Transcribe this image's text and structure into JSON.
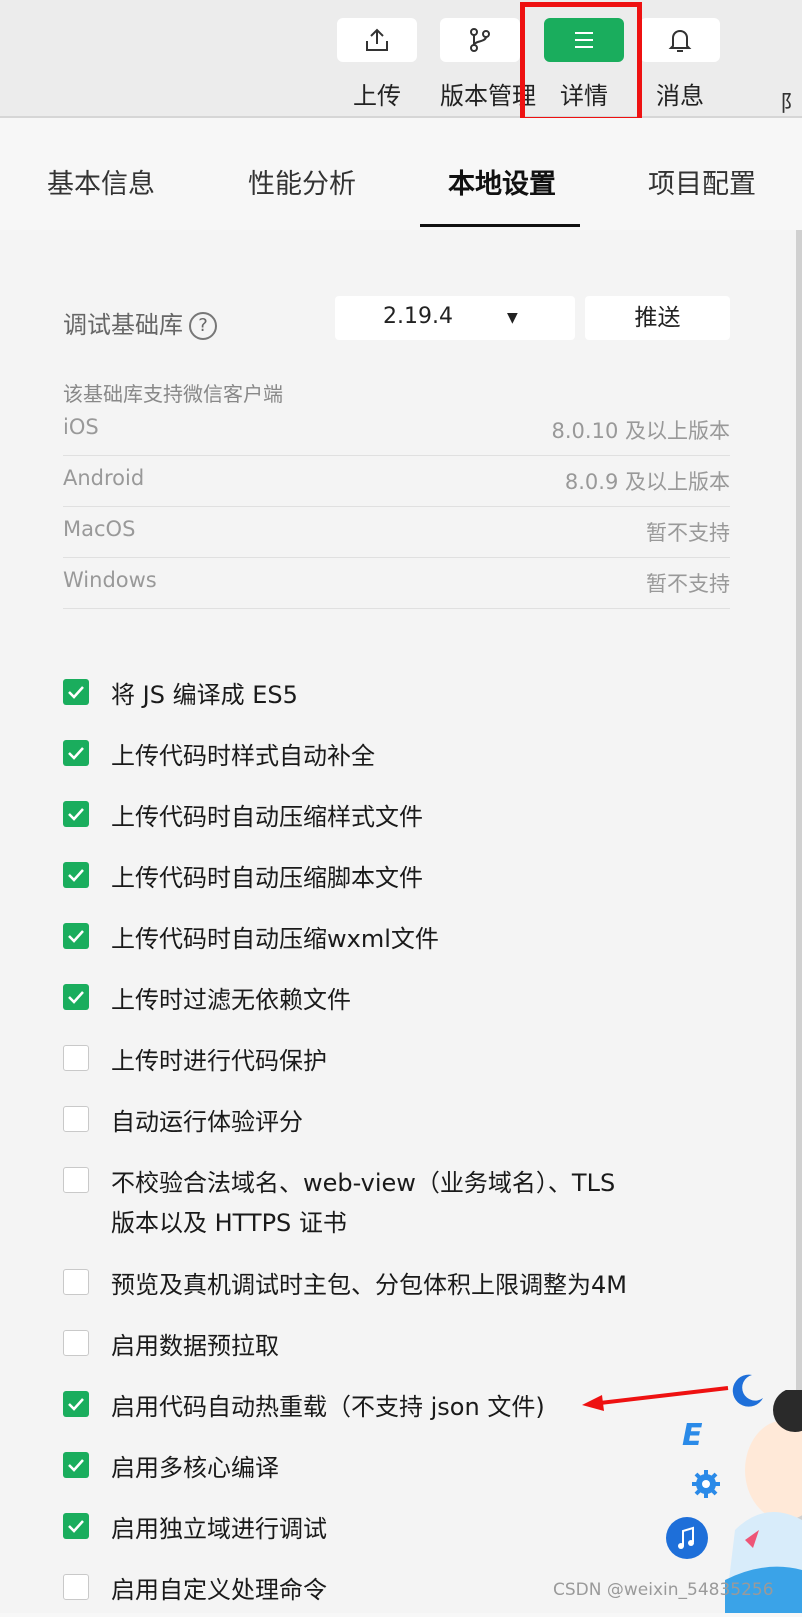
{
  "toolbar": {
    "items": [
      {
        "label": "上传",
        "icon": "upload-icon",
        "active": false
      },
      {
        "label": "版本管理",
        "icon": "branch-icon",
        "active": false
      },
      {
        "label": "详情",
        "icon": "menu-icon",
        "active": true
      },
      {
        "label": "消息",
        "icon": "bell-icon",
        "active": false
      }
    ],
    "accent_color": "#1aad5d",
    "highlight_color": "#ee1111"
  },
  "tabs": {
    "items": [
      {
        "label": "基本信息"
      },
      {
        "label": "性能分析"
      },
      {
        "label": "本地设置",
        "active": true
      },
      {
        "label": "项目配置"
      }
    ]
  },
  "debug_lib": {
    "label": "调试基础库",
    "help_icon": "?",
    "version": "2.19.4",
    "push_label": "推送",
    "support_caption": "该基础库支持微信客户端",
    "support": [
      {
        "platform": "iOS",
        "status": "8.0.10 及以上版本"
      },
      {
        "platform": "Android",
        "status": "8.0.9 及以上版本"
      },
      {
        "platform": "MacOS",
        "status": "暂不支持"
      },
      {
        "platform": "Windows",
        "status": "暂不支持"
      }
    ]
  },
  "options": [
    {
      "label": "将 JS 编译成 ES5",
      "checked": true
    },
    {
      "label": "上传代码时样式自动补全",
      "checked": true
    },
    {
      "label": "上传代码时自动压缩样式文件",
      "checked": true
    },
    {
      "label": "上传代码时自动压缩脚本文件",
      "checked": true
    },
    {
      "label": "上传代码时自动压缩wxml文件",
      "checked": true
    },
    {
      "label": "上传时过滤无依赖文件",
      "checked": true
    },
    {
      "label": "上传时进行代码保护",
      "checked": false
    },
    {
      "label": "自动运行体验评分",
      "checked": false
    },
    {
      "label": "不校验合法域名、web-view（业务域名）、TLS",
      "label2": "版本以及 HTTPS 证书",
      "checked": false
    },
    {
      "label": "预览及真机调试时主包、分包体积上限调整为4M",
      "checked": false
    },
    {
      "label": "启用数据预拉取",
      "checked": false
    },
    {
      "label": "启用代码自动热重载（不支持 json 文件)",
      "checked": true
    },
    {
      "label": "启用多核心编译",
      "checked": true
    },
    {
      "label": "启用独立域进行调试",
      "checked": true
    },
    {
      "label": "启用自定义处理命令",
      "checked": false
    }
  ],
  "watermark": "CSDN @weixin_54835256",
  "deco_letter": "E"
}
